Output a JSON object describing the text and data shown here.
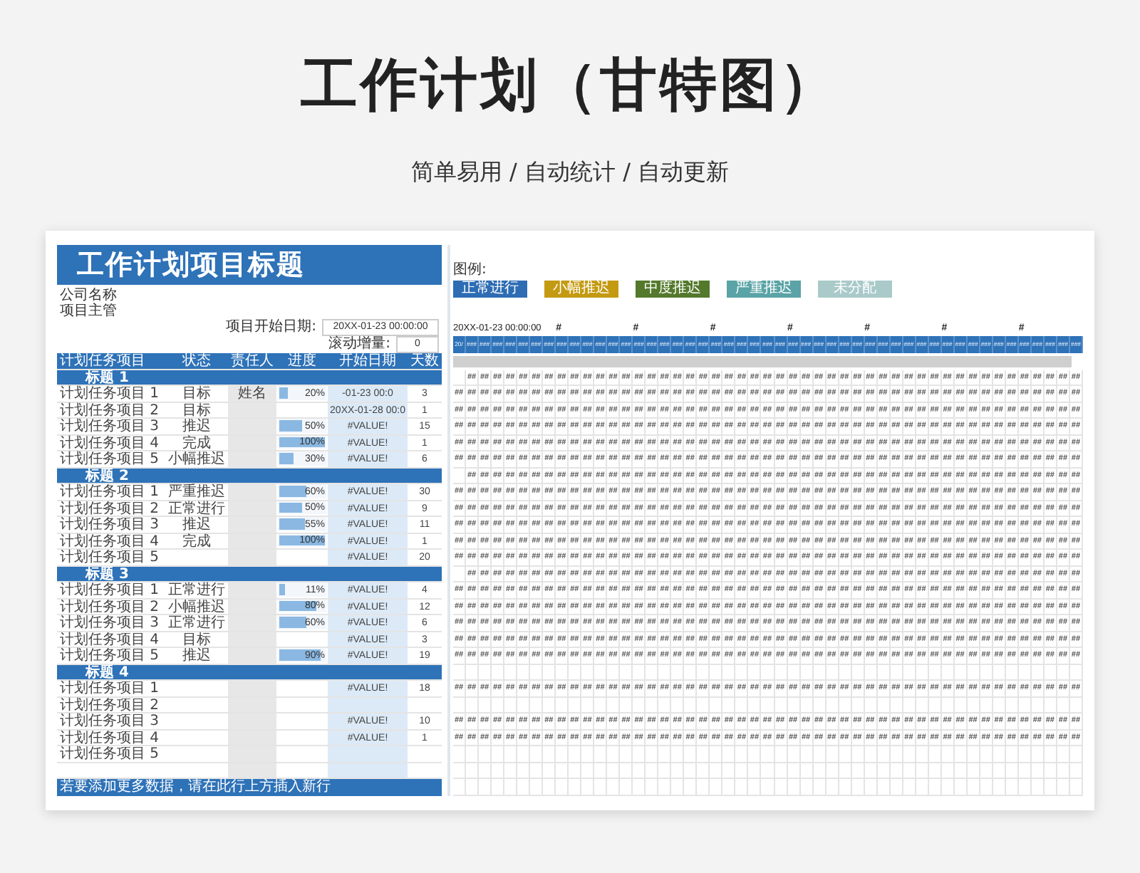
{
  "page_title": "工作计划（甘特图）",
  "tagline": "简单易用 / 自动统计 / 自动更新",
  "sheet": {
    "title": "工作计划项目标题",
    "company": "公司名称",
    "manager": "项目主管",
    "start_label": "项目开始日期:",
    "start_value": "20XX-01-23 00:00:00",
    "increment_label": "滚动增量:",
    "increment_value": "0",
    "columns": [
      "计划任务项目",
      "状态",
      "责任人",
      "进度",
      "开始日期",
      "天数"
    ],
    "groups": [
      {
        "heading": "标题 1",
        "cells": "## ## ## ## ## ## ## ## ## ## ## ## ## ## ## ## ## ## ## ## ## ## ## ## ## ## ## ## ## ## ## ## ## ## ## ## ## ## ## ## ## ## ## ## ## ## ## ##",
        "tasks": [
          {
            "name": "计划任务项目 1",
            "status": "目标",
            "owner": "姓名",
            "level": 0.2,
            "progress": "20%",
            "start": "-01-23 00:0",
            "days": "3",
            "cells": "## ## ## ## ## ## ## ## ## ## ## ## ## ## ## ## ## ## ## ## ## ## ## ## ## ## ## ## ## ## ## ## ## ## ## ## ## ## ## ## ## ## ## ## ## ## ## ## ##"
          },
          {
            "name": "计划任务项目 2",
            "status": "目标",
            "start": "20XX-01-28 00:0",
            "days": "1",
            "cells": "## ## ## ## ## ## ## ## ## ## ## ## ## ## ## ## ## ## ## ## ## ## ## ## ## ## ## ## ## ## ## ## ## ## ## ## ## ## ## ## ## ## ## ## ## ## ## ## ##"
          },
          {
            "name": "计划任务项目 3",
            "status": "推迟",
            "level": 0.5,
            "progress": "50%",
            "start": "#VALUE!",
            "days": "15",
            "cells": "## ## ## ## ## ## ## ## ## ## ## ## ## ## ## ## ## ## ## ## ## ## ## ## ## ## ## ## ## ## ## ## ## ## ## ## ## ## ## ## ## ## ## ## ## ## ## ## ##"
          },
          {
            "name": "计划任务项目 4",
            "status": "完成",
            "level": 1,
            "progress": "100%",
            "start": "#VALUE!",
            "days": "1",
            "cells": "## ## ## ## ## ## ## ## ## ## ## ## ## ## ## ## ## ## ## ## ## ## ## ## ## ## ## ## ## ## ## ## ## ## ## ## ## ## ## ## ## ## ## ## ## ## ## ## ##"
          },
          {
            "name": "计划任务项目 5",
            "status": "小幅推迟",
            "level": 0.3,
            "progress": "30%",
            "start": "#VALUE!",
            "days": "6",
            "cells": "## ## ## ## ## ## ## ## ## ## ## ## ## ## ## ## ## ## ## ## ## ## ## ## ## ## ## ## ## ## ## ## ## ## ## ## ## ## ## ## ## ## ## ## ## ## ## ## ##"
          }
        ]
      },
      {
        "heading": "标题 2",
        "cells": "## ## ## ## ## ## ## ## ## ## ## ## ## ## ## ## ## ## ## ## ## ## ## ## ## ## ## ## ## ## ## ## ## ## ## ## ## ## ## ## ## ## ## ## ## ## ## ##",
        "tasks": [
          {
            "name": "计划任务项目 1",
            "status": "严重推迟",
            "level": 0.6,
            "progress": "60%",
            "start": "#VALUE!",
            "days": "30",
            "cells": "## ## ## ## ## ## ## ## ## ## ## ## ## ## ## ## ## ## ## ## ## ## ## ## ## ## ## ## ## ## ## ## ## ## ## ## ## ## ## ## ## ## ## ## ## ## ## ## ##"
          },
          {
            "name": "计划任务项目 2",
            "status": "正常进行",
            "level": 0.5,
            "progress": "50%",
            "start": "#VALUE!",
            "days": "9",
            "cells": "## ## ## ## ## ## ## ## ## ## ## ## ## ## ## ## ## ## ## ## ## ## ## ## ## ## ## ## ## ## ## ## ## ## ## ## ## ## ## ## ## ## ## ## ## ## ## ## ##"
          },
          {
            "name": "计划任务项目 3",
            "status": "推迟",
            "level": 0.55,
            "progress": "55%",
            "start": "#VALUE!",
            "days": "11",
            "cells": "## ## ## ## ## ## ## ## ## ## ## ## ## ## ## ## ## ## ## ## ## ## ## ## ## ## ## ## ## ## ## ## ## ## ## ## ## ## ## ## ## ## ## ## ## ## ## ## ##"
          },
          {
            "name": "计划任务项目 4",
            "status": "完成",
            "level": 1,
            "progress": "100%",
            "start": "#VALUE!",
            "days": "1",
            "cells": "## ## ## ## ## ## ## ## ## ## ## ## ## ## ## ## ## ## ## ## ## ## ## ## ## ## ## ## ## ## ## ## ## ## ## ## ## ## ## ## ## ## ## ## ## ## ## ## ##"
          },
          {
            "name": "计划任务项目 5",
            "start": "#VALUE!",
            "days": "20",
            "cells": "## ## ## ## ## ## ## ## ## ## ## ## ## ## ## ## ## ## ## ## ## ## ## ## ## ## ## ## ## ## ## ## ## ## ## ## ## ## ## ## ## ## ## ## ## ## ## ## ##"
          }
        ]
      },
      {
        "heading": "标题 3",
        "cells": "## ## ## ## ## ## ## ## ## ## ## ## ## ## ## ## ## ## ## ## ## ## ## ## ## ## ## ## ## ## ## ## ## ## ## ## ## ## ## ## ## ## ## ## ## ## ## ##",
        "tasks": [
          {
            "name": "计划任务项目 1",
            "status": "正常进行",
            "level": 0.11,
            "progress": "11%",
            "start": "#VALUE!",
            "days": "4",
            "cells": "## ## ## ## ## ## ## ## ## ## ## ## ## ## ## ## ## ## ## ## ## ## ## ## ## ## ## ## ## ## ## ## ## ## ## ## ## ## ## ## ## ## ## ## ## ## ## ## ##"
          },
          {
            "name": "计划任务项目 2",
            "status": "小幅推迟",
            "level": 0.8,
            "progress": "80%",
            "start": "#VALUE!",
            "days": "12",
            "cells": "## ## ## ## ## ## ## ## ## ## ## ## ## ## ## ## ## ## ## ## ## ## ## ## ## ## ## ## ## ## ## ## ## ## ## ## ## ## ## ## ## ## ## ## ## ## ## ## ##"
          },
          {
            "name": "计划任务项目 3",
            "status": "正常进行",
            "level": 0.6,
            "progress": "60%",
            "start": "#VALUE!",
            "days": "6",
            "cells": "## ## ## ## ## ## ## ## ## ## ## ## ## ## ## ## ## ## ## ## ## ## ## ## ## ## ## ## ## ## ## ## ## ## ## ## ## ## ## ## ## ## ## ## ## ## ## ## ##"
          },
          {
            "name": "计划任务项目 4",
            "status": "目标",
            "start": "#VALUE!",
            "days": "3",
            "cells": "## ## ## ## ## ## ## ## ## ## ## ## ## ## ## ## ## ## ## ## ## ## ## ## ## ## ## ## ## ## ## ## ## ## ## ## ## ## ## ## ## ## ## ## ## ## ## ## ##"
          },
          {
            "name": "计划任务项目 5",
            "status": "推迟",
            "level": 0.9,
            "progress": "90%",
            "start": "#VALUE!",
            "days": "19",
            "cells": "## ## ## ## ## ## ## ## ## ## ## ## ## ## ## ## ## ## ## ## ## ## ## ## ## ## ## ## ## ## ## ## ## ## ## ## ## ## ## ## ## ## ## ## ## ## ## ## ##"
          }
        ]
      },
      {
        "heading": "标题 4",
        "tasks": [
          {
            "name": "计划任务项目 1",
            "start": "#VALUE!",
            "days": "18",
            "cells": "## ## ## ## ## ## ## ## ## ## ## ## ## ## ## ## ## ## ## ## ## ## ## ## ## ## ## ## ## ## ## ## ## ## ## ## ## ## ## ## ## ## ## ## ## ## ## ## ##"
          },
          {
            "name": "计划任务项目 2"
          },
          {
            "name": "计划任务项目 3",
            "start": "#VALUE!",
            "days": "10",
            "cells": "## ## ## ## ## ## ## ## ## ## ## ## ## ## ## ## ## ## ## ## ## ## ## ## ## ## ## ## ## ## ## ## ## ## ## ## ## ## ## ## ## ## ## ## ## ## ## ## ##"
          },
          {
            "name": "计划任务项目 4",
            "start": "#VALUE!",
            "days": "1",
            "cells": "## ## ## ## ## ## ## ## ## ## ## ## ## ## ## ## ## ## ## ## ## ## ## ## ## ## ## ## ## ## ## ## ## ## ## ## ## ## ## ## ## ## ## ## ## ## ## ## ##"
          },
          {
            "name": "计划任务项目 5"
          }
        ]
      }
    ],
    "footer": "若要添加更多数据，请在此行上方插入新行"
  },
  "gantt": {
    "legend_label": "图例:",
    "legend": [
      {
        "label": "正常进行",
        "color": "#2e6db4"
      },
      {
        "label": "小幅推迟",
        "color": "#c49a12"
      },
      {
        "label": "中度推迟",
        "color": "#54792c"
      },
      {
        "label": "严重推迟",
        "color": "#5aa3a6"
      },
      {
        "label": "未分配",
        "color": "#a9cac9"
      }
    ],
    "start_date": "20XX-01-23 00:00:00",
    "week_marks": [
      "#",
      "#",
      "#",
      "#",
      "#",
      "#",
      "#"
    ],
    "day_header": "20/ ### ### ### ### ### ### ### ### ### ### ### ### ### ### ### ### ### ### ### ### ### ### ### ### ### ### ### ### ### ### ### ### ### ### ### ### ### ### ### ### ### ### ### ### ### ### ### ###"
  }
}
